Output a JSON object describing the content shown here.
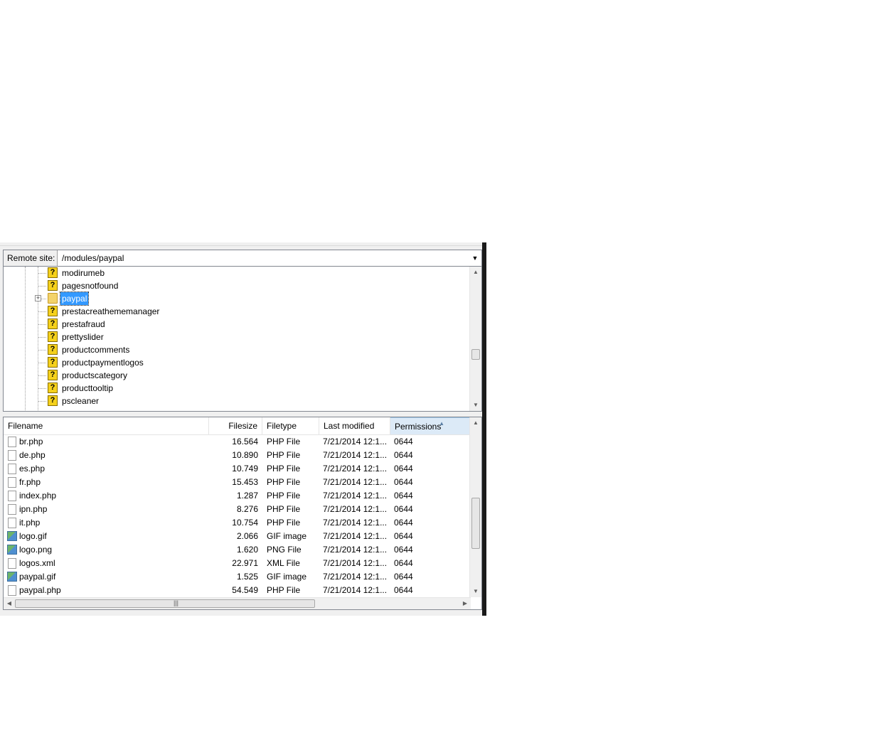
{
  "remote_site": {
    "label": "Remote site:",
    "path": "/modules/paypal"
  },
  "tree": {
    "items": [
      {
        "label": "modirumeb",
        "icon": "question-icon"
      },
      {
        "label": "pagesnotfound",
        "icon": "question-icon"
      },
      {
        "label": "paypal",
        "icon": "folder-icon",
        "selected": true,
        "expandable": true
      },
      {
        "label": "prestacreathememanager",
        "icon": "question-icon"
      },
      {
        "label": "prestafraud",
        "icon": "question-icon"
      },
      {
        "label": "prettyslider",
        "icon": "question-icon"
      },
      {
        "label": "productcomments",
        "icon": "question-icon"
      },
      {
        "label": "productpaymentlogos",
        "icon": "question-icon"
      },
      {
        "label": "productscategory",
        "icon": "question-icon"
      },
      {
        "label": "producttooltip",
        "icon": "question-icon"
      },
      {
        "label": "pscleaner",
        "icon": "question-icon"
      }
    ]
  },
  "file_list": {
    "columns": [
      "Filename",
      "Filesize",
      "Filetype",
      "Last modified",
      "Permissions"
    ],
    "sorted_column": "Permissions",
    "rows": [
      {
        "name": "br.php",
        "size": "16.564",
        "type": "PHP File",
        "modified": "7/21/2014 12:1...",
        "perm": "0644",
        "icon": "file-icon"
      },
      {
        "name": "de.php",
        "size": "10.890",
        "type": "PHP File",
        "modified": "7/21/2014 12:1...",
        "perm": "0644",
        "icon": "file-icon"
      },
      {
        "name": "es.php",
        "size": "10.749",
        "type": "PHP File",
        "modified": "7/21/2014 12:1...",
        "perm": "0644",
        "icon": "file-icon"
      },
      {
        "name": "fr.php",
        "size": "15.453",
        "type": "PHP File",
        "modified": "7/21/2014 12:1...",
        "perm": "0644",
        "icon": "file-icon"
      },
      {
        "name": "index.php",
        "size": "1.287",
        "type": "PHP File",
        "modified": "7/21/2014 12:1...",
        "perm": "0644",
        "icon": "file-icon"
      },
      {
        "name": "ipn.php",
        "size": "8.276",
        "type": "PHP File",
        "modified": "7/21/2014 12:1...",
        "perm": "0644",
        "icon": "file-icon"
      },
      {
        "name": "it.php",
        "size": "10.754",
        "type": "PHP File",
        "modified": "7/21/2014 12:1...",
        "perm": "0644",
        "icon": "file-icon"
      },
      {
        "name": "logo.gif",
        "size": "2.066",
        "type": "GIF image",
        "modified": "7/21/2014 12:1...",
        "perm": "0644",
        "icon": "image-icon"
      },
      {
        "name": "logo.png",
        "size": "1.620",
        "type": "PNG File",
        "modified": "7/21/2014 12:1...",
        "perm": "0644",
        "icon": "image-icon"
      },
      {
        "name": "logos.xml",
        "size": "22.971",
        "type": "XML File",
        "modified": "7/21/2014 12:1...",
        "perm": "0644",
        "icon": "file-icon"
      },
      {
        "name": "paypal.gif",
        "size": "1.525",
        "type": "GIF image",
        "modified": "7/21/2014 12:1...",
        "perm": "0644",
        "icon": "image-icon"
      },
      {
        "name": "paypal.php",
        "size": "54.549",
        "type": "PHP File",
        "modified": "7/21/2014 12:1...",
        "perm": "0644",
        "icon": "file-icon"
      }
    ]
  },
  "colors": {
    "selection": "#3399ff",
    "sorted_header": "#dceaf7",
    "panel_bg": "#f0f0f0"
  }
}
